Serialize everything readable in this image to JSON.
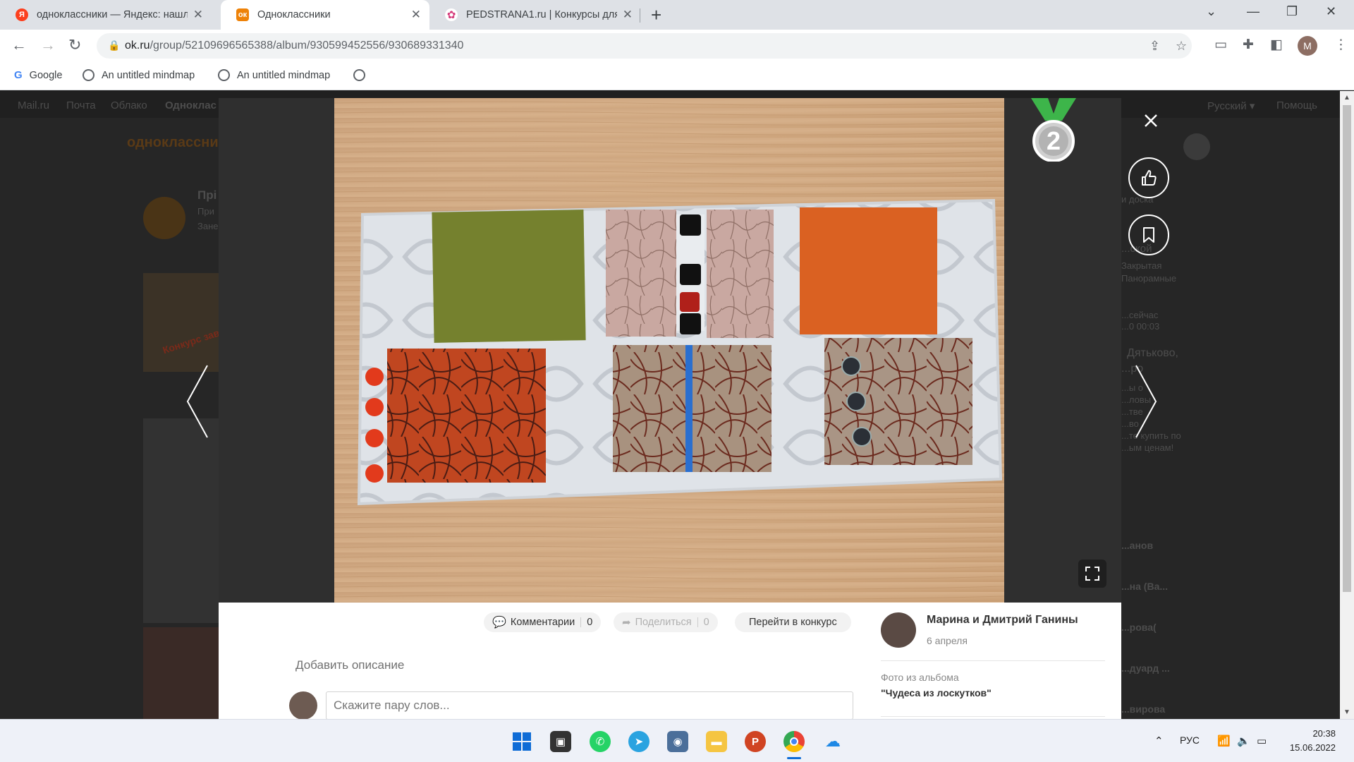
{
  "browser": {
    "tabs": [
      {
        "title": "одноклассники — Яндекс: нашл",
        "favicon": "yandex-icon",
        "color": "#fc3f1d",
        "glyph": "Я"
      },
      {
        "title": "Одноклассники",
        "favicon": "ok-icon",
        "color": "#ee8208",
        "glyph": "ок"
      },
      {
        "title": "PEDSTRANA1.ru | Конкурсы для",
        "favicon": "pedstrana-icon",
        "color": "#d43a7a",
        "glyph": "✿"
      }
    ],
    "url_host": "ok.ru",
    "url_path": "/group/52109696565388/album/930599452556/930689331340",
    "profile_initial": "М",
    "bookmarks": [
      {
        "label": "Google",
        "icon": "google-icon"
      },
      {
        "label": "An untitled mindmap",
        "icon": "globe-icon"
      },
      {
        "label": "An untitled mindmap",
        "icon": "globe-icon"
      },
      {
        "label": "",
        "icon": "globe-icon"
      }
    ]
  },
  "page_background": {
    "topnav": [
      "Mail.ru",
      "Почта",
      "Облако",
      "Одноклас"
    ],
    "right_nav": [
      "Русский ▾",
      "Помощь"
    ],
    "logo_text": "одноклассники",
    "sidebar_snippets": [
      "Прі",
      "При",
      "Зане"
    ],
    "right_snippets": [
      "и доска",
      "...ской",
      "Закрытая",
      "Панорамные",
      "...сейчас",
      "...0 00:03",
      "Дятьково,",
      "...ро",
      "...ы о",
      "...ловы",
      "...тве",
      "...во",
      "...те купить по",
      "...ым ценам!",
      "...анов",
      "...на (Ва...",
      "...рова(",
      "...дуард ...",
      "...вирова"
    ],
    "contest_badge": "Конкурс завершён"
  },
  "viewer": {
    "medal_number": "2",
    "medal_color": "#3db54a",
    "comments_label": "Комментарии",
    "comments_count": "0",
    "share_label": "Поделиться",
    "share_count": "0",
    "contest_label": "Перейти в конкурс",
    "add_description": "Добавить описание",
    "comment_placeholder": "Скажите пару слов...",
    "author_name": "Марина и Дмитрий Ганины",
    "date": "6 апреля",
    "album_caption": "Фото из альбома",
    "album_name": "\"Чудеса из лоскутков\""
  },
  "taskbar": {
    "language": "РУС",
    "time": "20:38",
    "date": "15.06.2022"
  }
}
